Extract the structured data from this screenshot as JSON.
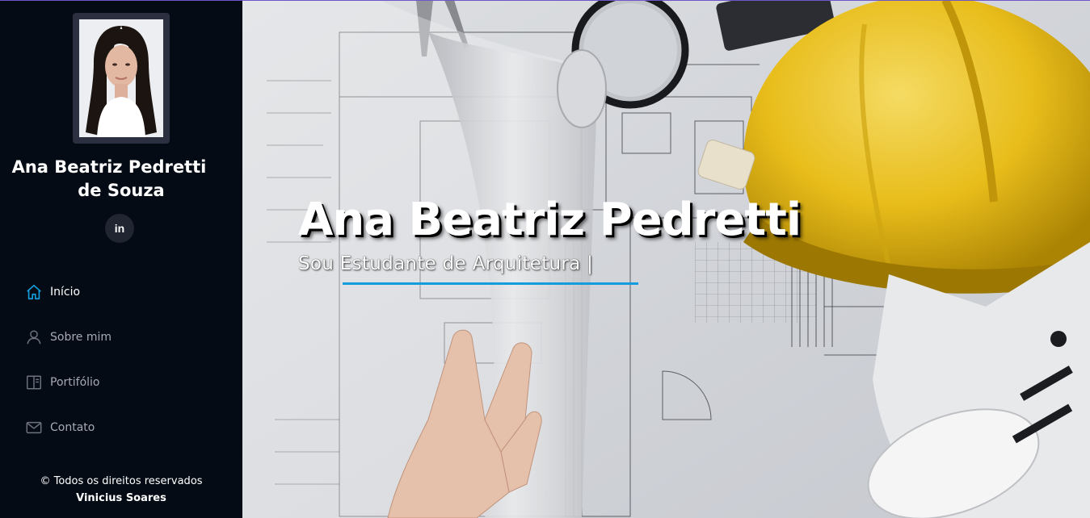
{
  "profile": {
    "name_line1": "Ana Beatriz Pedretti",
    "name_line2": "de Souza",
    "social_label": "in"
  },
  "nav": {
    "items": [
      {
        "label": "Início",
        "icon": "home-icon",
        "active": true
      },
      {
        "label": "Sobre mim",
        "icon": "person-icon",
        "active": false
      },
      {
        "label": "Portifólio",
        "icon": "portfolio-icon",
        "active": false
      },
      {
        "label": "Contato",
        "icon": "envelope-icon",
        "active": false
      }
    ]
  },
  "footer": {
    "copyright": "© Todos os direitos reservados",
    "credit": "Vinicius Soares"
  },
  "hero": {
    "title": "Ana Beatriz Pedretti",
    "subtitle": "Sou Estudante de Arquitetura |"
  },
  "colors": {
    "sidebar_bg": "#040b14",
    "accent": "#149ddd",
    "helmet": "#f2c51c"
  }
}
